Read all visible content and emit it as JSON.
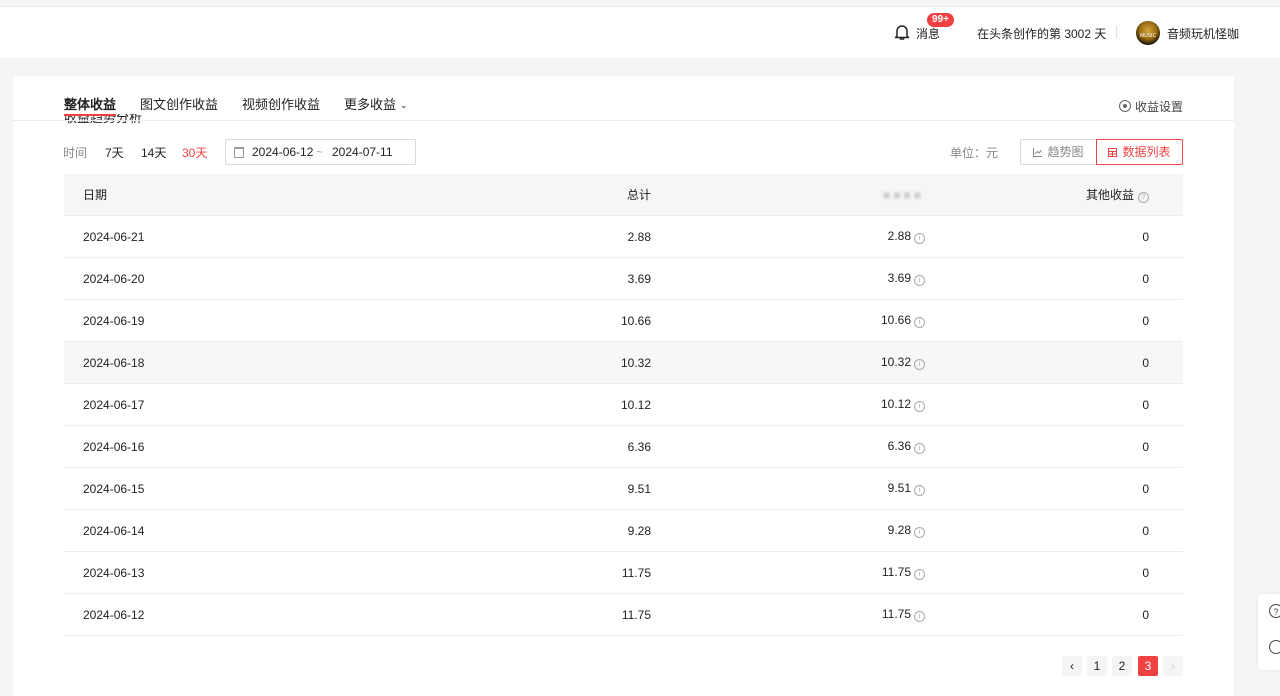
{
  "header": {
    "messages_label": "消息",
    "messages_badge": "99+",
    "days_text": "在头条创作的第 3002 天",
    "username": "音频玩机怪咖",
    "avatar_text": "MUSIC"
  },
  "tabs": {
    "overall": "整体收益",
    "article": "图文创作收益",
    "video": "视频创作收益",
    "more": "更多收益",
    "settings": "收益设置"
  },
  "section_title_partial": "收益趋势分析",
  "filter": {
    "time_label": "时间",
    "ranges": [
      "7天",
      "14天",
      "30天"
    ],
    "active_range": "30天",
    "start_date": "2024-06-12",
    "separator": "~",
    "end_date": "2024-07-11",
    "unit_label": "单位：元",
    "trend_button": "趋势图",
    "list_button": "数据列表"
  },
  "table": {
    "headers": [
      "日期",
      "总计",
      "",
      "其他收益"
    ],
    "rows": [
      {
        "date": "2024-06-21",
        "total": "2.88",
        "detail": "2.88",
        "other": "0"
      },
      {
        "date": "2024-06-20",
        "total": "3.69",
        "detail": "3.69",
        "other": "0"
      },
      {
        "date": "2024-06-19",
        "total": "10.66",
        "detail": "10.66",
        "other": "0"
      },
      {
        "date": "2024-06-18",
        "total": "10.32",
        "detail": "10.32",
        "other": "0"
      },
      {
        "date": "2024-06-17",
        "total": "10.12",
        "detail": "10.12",
        "other": "0"
      },
      {
        "date": "2024-06-16",
        "total": "6.36",
        "detail": "6.36",
        "other": "0"
      },
      {
        "date": "2024-06-15",
        "total": "9.51",
        "detail": "9.51",
        "other": "0"
      },
      {
        "date": "2024-06-14",
        "total": "9.28",
        "detail": "9.28",
        "other": "0"
      },
      {
        "date": "2024-06-13",
        "total": "11.75",
        "detail": "11.75",
        "other": "0"
      },
      {
        "date": "2024-06-12",
        "total": "11.75",
        "detail": "11.75",
        "other": "0"
      }
    ],
    "highlighted_row": 3
  },
  "pagination": {
    "prev": "‹",
    "pages": [
      "1",
      "2",
      "3"
    ],
    "active_page": "3",
    "next": "›"
  },
  "colors": {
    "accent": "#f04142",
    "header_bg": "#f5f6f7"
  },
  "side_icons": [
    "help-icon",
    "customer-service-icon"
  ]
}
